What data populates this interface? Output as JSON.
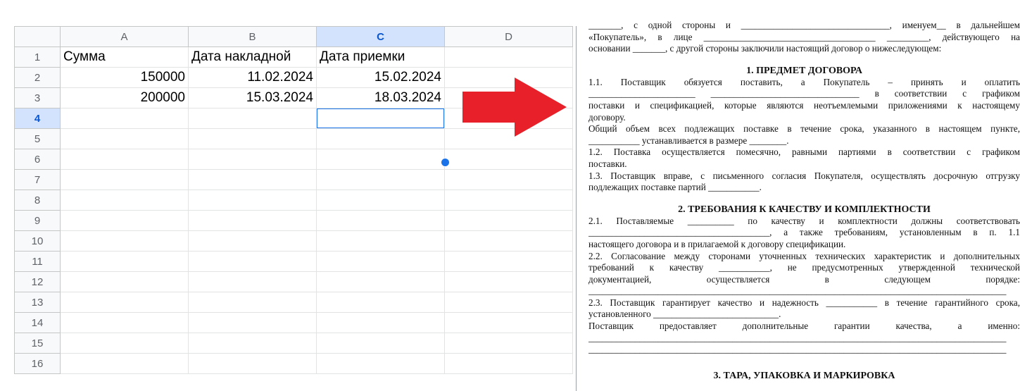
{
  "spreadsheet": {
    "columns": [
      "A",
      "B",
      "C",
      "D"
    ],
    "rows": [
      "1",
      "2",
      "3",
      "4",
      "5",
      "6",
      "7",
      "8",
      "9",
      "10",
      "11",
      "12",
      "13",
      "14",
      "15",
      "16"
    ],
    "cells": [
      [
        "Сумма",
        "Дата накладной",
        "Дата приемки",
        ""
      ],
      [
        "150000",
        "11.02.2024",
        "15.02.2024",
        ""
      ],
      [
        "200000",
        "15.03.2024",
        "18.03.2024",
        ""
      ]
    ],
    "selected_cell": "C4",
    "selection_color": "#1a73e8"
  },
  "arrow": {
    "color": "#e8202a",
    "icon": "arrow-right-icon"
  },
  "document": {
    "intro": [
      "_______, с одной стороны и ________________________________, именуем__ в дальнейшем",
      "«Покупатель», в лице _____________________________________ _________, действующего на",
      "основании _______, с другой стороны заключили настоящий договор о нижеследующем:"
    ],
    "section1": {
      "title": "1. ПРЕДМЕТ ДОГОВОРА",
      "lines": [
        "1.1. Поставщик обязуется поставить, а Покупатель – принять и оплатить",
        "_______________________ ________________________________ в соответствии с графиком",
        "поставки и спецификацией, которые являются неотъемлемыми приложениями к настоящему",
        "договору.",
        "Общий объем всех подлежащих поставке в течение срока, указанного в настоящем пункте,",
        "___________ устанавливается в размере ________.",
        "1.2. Поставка осуществляется помесячно, равными партиями в соответствии с графиком",
        "поставки.",
        "1.3. Поставщик вправе, с письменного согласия Покупателя, осуществлять досрочную отгрузку",
        "подлежащих поставке партий ___________."
      ]
    },
    "section2": {
      "title": "2. ТРЕБОВАНИЯ К КАЧЕСТВУ И КОМПЛЕКТНОСТИ",
      "lines": [
        "2.1. Поставляемые __________ по качеству и комплектности должны соответствовать",
        "_______________________________________, а также требованиям, установленным в п. 1.1",
        "настоящего договора и в прилагаемой к договору спецификации.",
        "2.2. Согласование между сторонами уточненных технических характеристик и дополнительных",
        "требований к качеству ___________, не предусмотренных утвержденной технической",
        "документацией, осуществляется в следующем порядке:",
        "__________________________________________________________________________________________",
        "2.3. Поставщик гарантирует качество и надежность ___________ в течение гарантийного срока,",
        "установленного ___________________________.",
        "Поставщик предоставляет дополнительные гарантии качества, а именно:",
        "__________________________________________________________________________________________",
        "__________________________________________________________________________________________"
      ]
    },
    "section3": {
      "title": "3. ТАРА, УПАКОВКА И МАРКИРОВКА"
    }
  }
}
